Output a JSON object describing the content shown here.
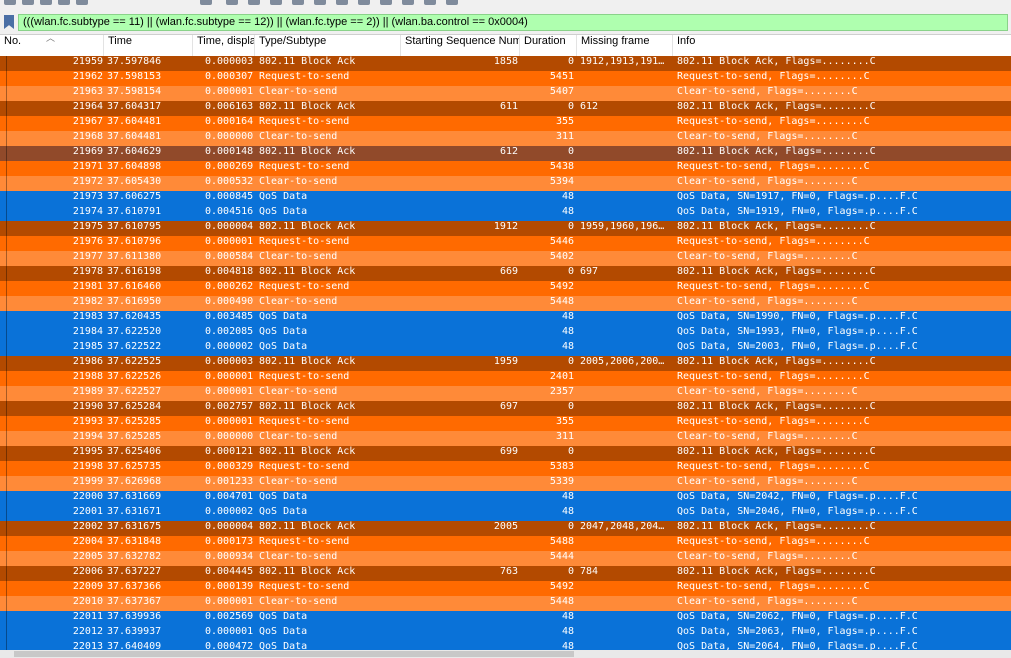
{
  "filter": {
    "expression": "(((wlan.fc.subtype == 11) || (wlan.fc.subtype == 12)) || (wlan.fc.type == 2)) || (wlan.ba.control == 0x0004)",
    "color": "#afffaf"
  },
  "columns": [
    "No.",
    "Time",
    "Time, displa",
    "Type/Subtype",
    "Starting Sequence Num",
    "Duration",
    "Missing frame",
    "Info"
  ],
  "colors": {
    "block_ack": "#b34a00",
    "block_ack_selected": "#914a2a",
    "rts": "#ff6a00",
    "cts": "#ff8a38",
    "qos": "#0a72d8",
    "text": "#ffffff"
  },
  "packets": [
    {
      "no": "21959",
      "time": "37.597846",
      "delta": "0.000003",
      "type": "802.11 Block Ack",
      "seq": "1858",
      "dur": "0",
      "missing": "1912,1913,191…",
      "info": "802.11 Block Ack, Flags=........C",
      "kind": "ba"
    },
    {
      "no": "21962",
      "time": "37.598153",
      "delta": "0.000307",
      "type": "Request-to-send",
      "seq": "",
      "dur": "5451",
      "missing": "",
      "info": "Request-to-send, Flags=........C",
      "kind": "rts"
    },
    {
      "no": "21963",
      "time": "37.598154",
      "delta": "0.000001",
      "type": "Clear-to-send",
      "seq": "",
      "dur": "5407",
      "missing": "",
      "info": "Clear-to-send, Flags=........C",
      "kind": "cts"
    },
    {
      "no": "21964",
      "time": "37.604317",
      "delta": "0.006163",
      "type": "802.11 Block Ack",
      "seq": "611",
      "dur": "0",
      "missing": "612",
      "info": "802.11 Block Ack, Flags=........C",
      "kind": "ba"
    },
    {
      "no": "21967",
      "time": "37.604481",
      "delta": "0.000164",
      "type": "Request-to-send",
      "seq": "",
      "dur": "355",
      "missing": "",
      "info": "Request-to-send, Flags=........C",
      "kind": "rts"
    },
    {
      "no": "21968",
      "time": "37.604481",
      "delta": "0.000000",
      "type": "Clear-to-send",
      "seq": "",
      "dur": "311",
      "missing": "",
      "info": "Clear-to-send, Flags=........C",
      "kind": "cts"
    },
    {
      "no": "21969",
      "time": "37.604629",
      "delta": "0.000148",
      "type": "802.11 Block Ack",
      "seq": "612",
      "dur": "0",
      "missing": "",
      "info": "802.11 Block Ack, Flags=........C",
      "kind": "ba2"
    },
    {
      "no": "21971",
      "time": "37.604898",
      "delta": "0.000269",
      "type": "Request-to-send",
      "seq": "",
      "dur": "5438",
      "missing": "",
      "info": "Request-to-send, Flags=........C",
      "kind": "rts"
    },
    {
      "no": "21972",
      "time": "37.605430",
      "delta": "0.000532",
      "type": "Clear-to-send",
      "seq": "",
      "dur": "5394",
      "missing": "",
      "info": "Clear-to-send, Flags=........C",
      "kind": "cts"
    },
    {
      "no": "21973",
      "time": "37.606275",
      "delta": "0.000845",
      "type": "QoS Data",
      "seq": "",
      "dur": "48",
      "missing": "",
      "info": "QoS Data, SN=1917, FN=0, Flags=.p....F.C",
      "kind": "qos"
    },
    {
      "no": "21974",
      "time": "37.610791",
      "delta": "0.004516",
      "type": "QoS Data",
      "seq": "",
      "dur": "48",
      "missing": "",
      "info": "QoS Data, SN=1919, FN=0, Flags=.p....F.C",
      "kind": "qos"
    },
    {
      "no": "21975",
      "time": "37.610795",
      "delta": "0.000004",
      "type": "802.11 Block Ack",
      "seq": "1912",
      "dur": "0",
      "missing": "1959,1960,196…",
      "info": "802.11 Block Ack, Flags=........C",
      "kind": "ba"
    },
    {
      "no": "21976",
      "time": "37.610796",
      "delta": "0.000001",
      "type": "Request-to-send",
      "seq": "",
      "dur": "5446",
      "missing": "",
      "info": "Request-to-send, Flags=........C",
      "kind": "rts"
    },
    {
      "no": "21977",
      "time": "37.611380",
      "delta": "0.000584",
      "type": "Clear-to-send",
      "seq": "",
      "dur": "5402",
      "missing": "",
      "info": "Clear-to-send, Flags=........C",
      "kind": "cts"
    },
    {
      "no": "21978",
      "time": "37.616198",
      "delta": "0.004818",
      "type": "802.11 Block Ack",
      "seq": "669",
      "dur": "0",
      "missing": "697",
      "info": "802.11 Block Ack, Flags=........C",
      "kind": "ba"
    },
    {
      "no": "21981",
      "time": "37.616460",
      "delta": "0.000262",
      "type": "Request-to-send",
      "seq": "",
      "dur": "5492",
      "missing": "",
      "info": "Request-to-send, Flags=........C",
      "kind": "rts"
    },
    {
      "no": "21982",
      "time": "37.616950",
      "delta": "0.000490",
      "type": "Clear-to-send",
      "seq": "",
      "dur": "5448",
      "missing": "",
      "info": "Clear-to-send, Flags=........C",
      "kind": "cts"
    },
    {
      "no": "21983",
      "time": "37.620435",
      "delta": "0.003485",
      "type": "QoS Data",
      "seq": "",
      "dur": "48",
      "missing": "",
      "info": "QoS Data, SN=1990, FN=0, Flags=.p....F.C",
      "kind": "qos"
    },
    {
      "no": "21984",
      "time": "37.622520",
      "delta": "0.002085",
      "type": "QoS Data",
      "seq": "",
      "dur": "48",
      "missing": "",
      "info": "QoS Data, SN=1993, FN=0, Flags=.p....F.C",
      "kind": "qos"
    },
    {
      "no": "21985",
      "time": "37.622522",
      "delta": "0.000002",
      "type": "QoS Data",
      "seq": "",
      "dur": "48",
      "missing": "",
      "info": "QoS Data, SN=2003, FN=0, Flags=.p....F.C",
      "kind": "qos"
    },
    {
      "no": "21986",
      "time": "37.622525",
      "delta": "0.000003",
      "type": "802.11 Block Ack",
      "seq": "1959",
      "dur": "0",
      "missing": "2005,2006,200…",
      "info": "802.11 Block Ack, Flags=........C",
      "kind": "ba"
    },
    {
      "no": "21988",
      "time": "37.622526",
      "delta": "0.000001",
      "type": "Request-to-send",
      "seq": "",
      "dur": "2401",
      "missing": "",
      "info": "Request-to-send, Flags=........C",
      "kind": "rts"
    },
    {
      "no": "21989",
      "time": "37.622527",
      "delta": "0.000001",
      "type": "Clear-to-send",
      "seq": "",
      "dur": "2357",
      "missing": "",
      "info": "Clear-to-send, Flags=........C",
      "kind": "cts"
    },
    {
      "no": "21990",
      "time": "37.625284",
      "delta": "0.002757",
      "type": "802.11 Block Ack",
      "seq": "697",
      "dur": "0",
      "missing": "",
      "info": "802.11 Block Ack, Flags=........C",
      "kind": "ba"
    },
    {
      "no": "21993",
      "time": "37.625285",
      "delta": "0.000001",
      "type": "Request-to-send",
      "seq": "",
      "dur": "355",
      "missing": "",
      "info": "Request-to-send, Flags=........C",
      "kind": "rts"
    },
    {
      "no": "21994",
      "time": "37.625285",
      "delta": "0.000000",
      "type": "Clear-to-send",
      "seq": "",
      "dur": "311",
      "missing": "",
      "info": "Clear-to-send, Flags=........C",
      "kind": "cts"
    },
    {
      "no": "21995",
      "time": "37.625406",
      "delta": "0.000121",
      "type": "802.11 Block Ack",
      "seq": "699",
      "dur": "0",
      "missing": "",
      "info": "802.11 Block Ack, Flags=........C",
      "kind": "ba"
    },
    {
      "no": "21998",
      "time": "37.625735",
      "delta": "0.000329",
      "type": "Request-to-send",
      "seq": "",
      "dur": "5383",
      "missing": "",
      "info": "Request-to-send, Flags=........C",
      "kind": "rts"
    },
    {
      "no": "21999",
      "time": "37.626968",
      "delta": "0.001233",
      "type": "Clear-to-send",
      "seq": "",
      "dur": "5339",
      "missing": "",
      "info": "Clear-to-send, Flags=........C",
      "kind": "cts"
    },
    {
      "no": "22000",
      "time": "37.631669",
      "delta": "0.004701",
      "type": "QoS Data",
      "seq": "",
      "dur": "48",
      "missing": "",
      "info": "QoS Data, SN=2042, FN=0, Flags=.p....F.C",
      "kind": "qos"
    },
    {
      "no": "22001",
      "time": "37.631671",
      "delta": "0.000002",
      "type": "QoS Data",
      "seq": "",
      "dur": "48",
      "missing": "",
      "info": "QoS Data, SN=2046, FN=0, Flags=.p....F.C",
      "kind": "qos"
    },
    {
      "no": "22002",
      "time": "37.631675",
      "delta": "0.000004",
      "type": "802.11 Block Ack",
      "seq": "2005",
      "dur": "0",
      "missing": "2047,2048,204…",
      "info": "802.11 Block Ack, Flags=........C",
      "kind": "ba"
    },
    {
      "no": "22004",
      "time": "37.631848",
      "delta": "0.000173",
      "type": "Request-to-send",
      "seq": "",
      "dur": "5488",
      "missing": "",
      "info": "Request-to-send, Flags=........C",
      "kind": "rts"
    },
    {
      "no": "22005",
      "time": "37.632782",
      "delta": "0.000934",
      "type": "Clear-to-send",
      "seq": "",
      "dur": "5444",
      "missing": "",
      "info": "Clear-to-send, Flags=........C",
      "kind": "cts"
    },
    {
      "no": "22006",
      "time": "37.637227",
      "delta": "0.004445",
      "type": "802.11 Block Ack",
      "seq": "763",
      "dur": "0",
      "missing": "784",
      "info": "802.11 Block Ack, Flags=........C",
      "kind": "ba"
    },
    {
      "no": "22009",
      "time": "37.637366",
      "delta": "0.000139",
      "type": "Request-to-send",
      "seq": "",
      "dur": "5492",
      "missing": "",
      "info": "Request-to-send, Flags=........C",
      "kind": "rts"
    },
    {
      "no": "22010",
      "time": "37.637367",
      "delta": "0.000001",
      "type": "Clear-to-send",
      "seq": "",
      "dur": "5448",
      "missing": "",
      "info": "Clear-to-send, Flags=........C",
      "kind": "cts"
    },
    {
      "no": "22011",
      "time": "37.639936",
      "delta": "0.002569",
      "type": "QoS Data",
      "seq": "",
      "dur": "48",
      "missing": "",
      "info": "QoS Data, SN=2062, FN=0, Flags=.p....F.C",
      "kind": "qos"
    },
    {
      "no": "22012",
      "time": "37.639937",
      "delta": "0.000001",
      "type": "QoS Data",
      "seq": "",
      "dur": "48",
      "missing": "",
      "info": "QoS Data, SN=2063, FN=0, Flags=.p....F.C",
      "kind": "qos"
    },
    {
      "no": "22013",
      "time": "37.640409",
      "delta": "0.000472",
      "type": "QoS Data",
      "seq": "",
      "dur": "48",
      "missing": "",
      "info": "QoS Data, SN=2064, FN=0, Flags=.p....F.C",
      "kind": "qos"
    }
  ]
}
